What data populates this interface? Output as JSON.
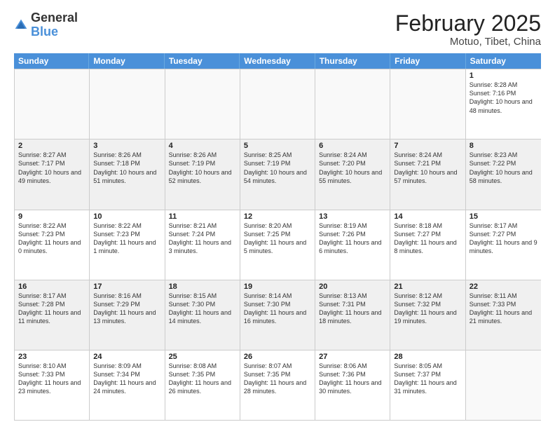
{
  "logo": {
    "general": "General",
    "blue": "Blue"
  },
  "header": {
    "month": "February 2025",
    "location": "Motuo, Tibet, China"
  },
  "weekdays": [
    "Sunday",
    "Monday",
    "Tuesday",
    "Wednesday",
    "Thursday",
    "Friday",
    "Saturday"
  ],
  "weeks": [
    [
      {
        "day": "",
        "info": "",
        "empty": true
      },
      {
        "day": "",
        "info": "",
        "empty": true
      },
      {
        "day": "",
        "info": "",
        "empty": true
      },
      {
        "day": "",
        "info": "",
        "empty": true
      },
      {
        "day": "",
        "info": "",
        "empty": true
      },
      {
        "day": "",
        "info": "",
        "empty": true
      },
      {
        "day": "1",
        "info": "Sunrise: 8:28 AM\nSunset: 7:16 PM\nDaylight: 10 hours and 48 minutes."
      }
    ],
    [
      {
        "day": "2",
        "info": "Sunrise: 8:27 AM\nSunset: 7:17 PM\nDaylight: 10 hours and 49 minutes."
      },
      {
        "day": "3",
        "info": "Sunrise: 8:26 AM\nSunset: 7:18 PM\nDaylight: 10 hours and 51 minutes."
      },
      {
        "day": "4",
        "info": "Sunrise: 8:26 AM\nSunset: 7:19 PM\nDaylight: 10 hours and 52 minutes."
      },
      {
        "day": "5",
        "info": "Sunrise: 8:25 AM\nSunset: 7:19 PM\nDaylight: 10 hours and 54 minutes."
      },
      {
        "day": "6",
        "info": "Sunrise: 8:24 AM\nSunset: 7:20 PM\nDaylight: 10 hours and 55 minutes."
      },
      {
        "day": "7",
        "info": "Sunrise: 8:24 AM\nSunset: 7:21 PM\nDaylight: 10 hours and 57 minutes."
      },
      {
        "day": "8",
        "info": "Sunrise: 8:23 AM\nSunset: 7:22 PM\nDaylight: 10 hours and 58 minutes."
      }
    ],
    [
      {
        "day": "9",
        "info": "Sunrise: 8:22 AM\nSunset: 7:23 PM\nDaylight: 11 hours and 0 minutes."
      },
      {
        "day": "10",
        "info": "Sunrise: 8:22 AM\nSunset: 7:23 PM\nDaylight: 11 hours and 1 minute."
      },
      {
        "day": "11",
        "info": "Sunrise: 8:21 AM\nSunset: 7:24 PM\nDaylight: 11 hours and 3 minutes."
      },
      {
        "day": "12",
        "info": "Sunrise: 8:20 AM\nSunset: 7:25 PM\nDaylight: 11 hours and 5 minutes."
      },
      {
        "day": "13",
        "info": "Sunrise: 8:19 AM\nSunset: 7:26 PM\nDaylight: 11 hours and 6 minutes."
      },
      {
        "day": "14",
        "info": "Sunrise: 8:18 AM\nSunset: 7:27 PM\nDaylight: 11 hours and 8 minutes."
      },
      {
        "day": "15",
        "info": "Sunrise: 8:17 AM\nSunset: 7:27 PM\nDaylight: 11 hours and 9 minutes."
      }
    ],
    [
      {
        "day": "16",
        "info": "Sunrise: 8:17 AM\nSunset: 7:28 PM\nDaylight: 11 hours and 11 minutes."
      },
      {
        "day": "17",
        "info": "Sunrise: 8:16 AM\nSunset: 7:29 PM\nDaylight: 11 hours and 13 minutes."
      },
      {
        "day": "18",
        "info": "Sunrise: 8:15 AM\nSunset: 7:30 PM\nDaylight: 11 hours and 14 minutes."
      },
      {
        "day": "19",
        "info": "Sunrise: 8:14 AM\nSunset: 7:30 PM\nDaylight: 11 hours and 16 minutes."
      },
      {
        "day": "20",
        "info": "Sunrise: 8:13 AM\nSunset: 7:31 PM\nDaylight: 11 hours and 18 minutes."
      },
      {
        "day": "21",
        "info": "Sunrise: 8:12 AM\nSunset: 7:32 PM\nDaylight: 11 hours and 19 minutes."
      },
      {
        "day": "22",
        "info": "Sunrise: 8:11 AM\nSunset: 7:33 PM\nDaylight: 11 hours and 21 minutes."
      }
    ],
    [
      {
        "day": "23",
        "info": "Sunrise: 8:10 AM\nSunset: 7:33 PM\nDaylight: 11 hours and 23 minutes."
      },
      {
        "day": "24",
        "info": "Sunrise: 8:09 AM\nSunset: 7:34 PM\nDaylight: 11 hours and 24 minutes."
      },
      {
        "day": "25",
        "info": "Sunrise: 8:08 AM\nSunset: 7:35 PM\nDaylight: 11 hours and 26 minutes."
      },
      {
        "day": "26",
        "info": "Sunrise: 8:07 AM\nSunset: 7:35 PM\nDaylight: 11 hours and 28 minutes."
      },
      {
        "day": "27",
        "info": "Sunrise: 8:06 AM\nSunset: 7:36 PM\nDaylight: 11 hours and 30 minutes."
      },
      {
        "day": "28",
        "info": "Sunrise: 8:05 AM\nSunset: 7:37 PM\nDaylight: 11 hours and 31 minutes."
      },
      {
        "day": "",
        "info": "",
        "empty": true
      }
    ]
  ]
}
